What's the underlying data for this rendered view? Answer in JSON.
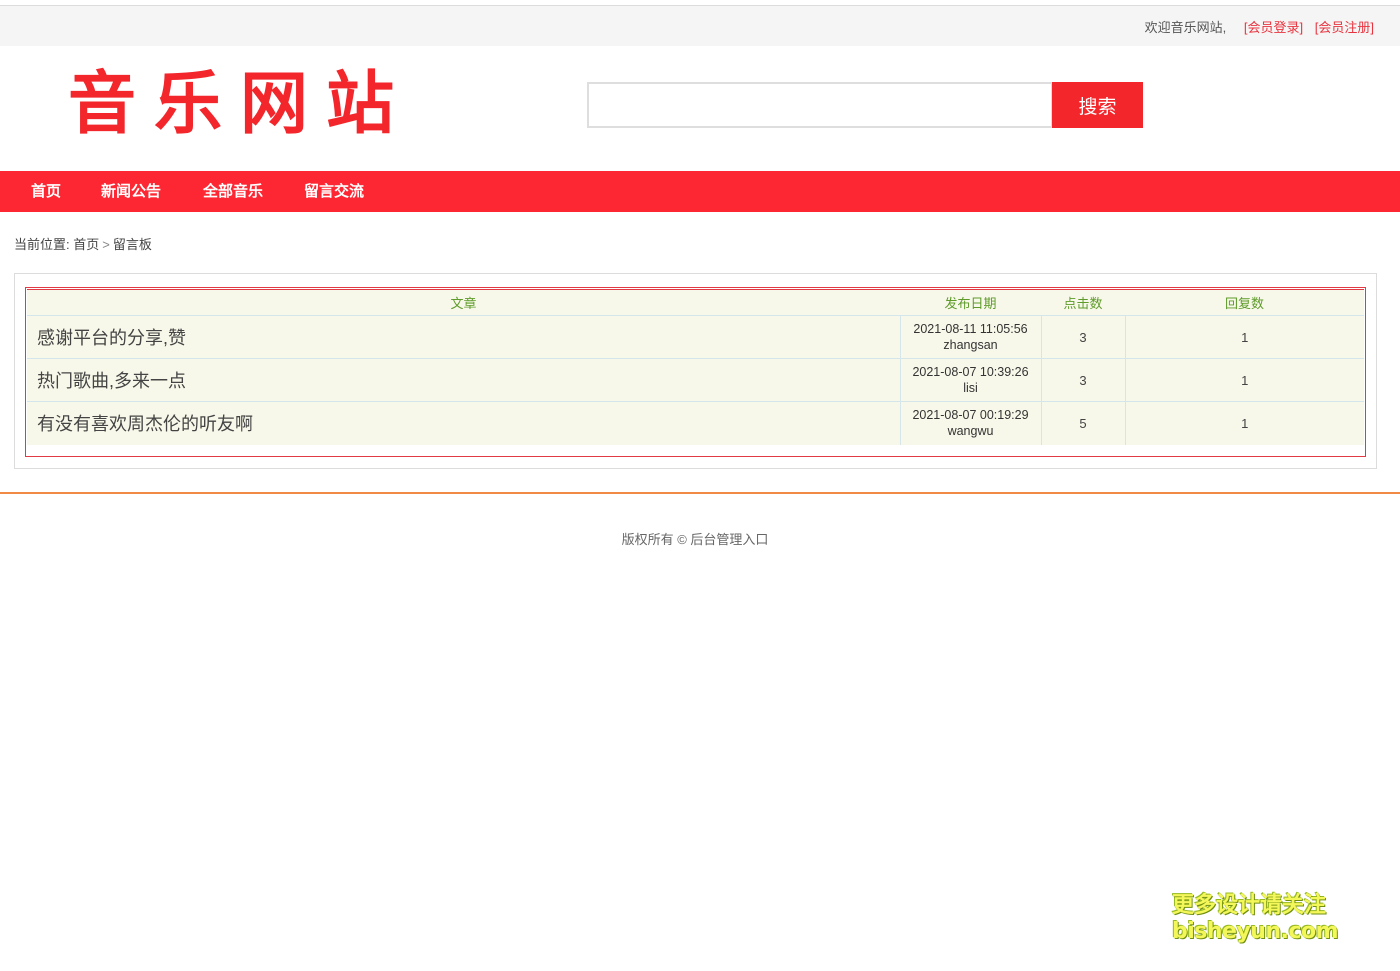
{
  "topbar": {
    "welcome": "欢迎音乐网站,",
    "login": "[会员登录]",
    "register": "[会员注册]"
  },
  "header": {
    "logo": "音乐网站",
    "search_value": "",
    "search_button": "搜索"
  },
  "nav": {
    "items": [
      {
        "label": "首页"
      },
      {
        "label": "新闻公告"
      },
      {
        "label": "全部音乐"
      },
      {
        "label": "留言交流"
      }
    ]
  },
  "breadcrumb": {
    "prefix": "当前位置:",
    "home": "首页",
    "separator": ">",
    "current": "留言板"
  },
  "table": {
    "headers": {
      "title": "文章",
      "date": "发布日期",
      "clicks": "点击数",
      "replies": "回复数"
    },
    "rows": [
      {
        "title": "感谢平台的分享,赞",
        "date": "2021-08-11 11:05:56",
        "author": "zhangsan",
        "clicks": "3",
        "replies": "1"
      },
      {
        "title": "热门歌曲,多来一点",
        "date": "2021-08-07 10:39:26",
        "author": "lisi",
        "clicks": "3",
        "replies": "1"
      },
      {
        "title": "有没有喜欢周杰伦的听友啊",
        "date": "2021-08-07 00:19:29",
        "author": "wangwu",
        "clicks": "5",
        "replies": "1"
      }
    ]
  },
  "footer": {
    "text": "版权所有 © 后台管理入口"
  },
  "watermark": {
    "line1": "更多设计请关注",
    "line2": "bisheyun.com"
  },
  "colors": {
    "brand_red": "#f2262b",
    "nav_red": "#fc2732",
    "header_green": "#5e9b2a",
    "table_bg": "#f8f8ea",
    "divider_orange": "#f08a45"
  }
}
